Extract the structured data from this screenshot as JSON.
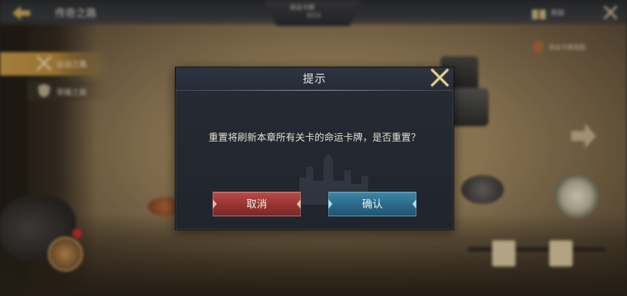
{
  "topbar": {
    "title": "传奇之路",
    "center_tab_line1": "命运卡牌",
    "center_tab_line2": "0/12"
  },
  "side_tabs": [
    {
      "label": "征战之路"
    },
    {
      "label": "荣耀之路"
    }
  ],
  "right_panel": {
    "top_label": "奖励",
    "sub_label": "命运卡牌奖励"
  },
  "dialog": {
    "title": "提示",
    "message": "重置将刷新本章所有关卡的命运卡牌，是否重置？",
    "cancel_label": "取消",
    "confirm_label": "确认"
  },
  "colors": {
    "cancel_button": "#923230",
    "confirm_button": "#2a6686",
    "close_icon": "#d8c48f",
    "dialog_bg": "#232830"
  },
  "icons": [
    "back-arrow-icon",
    "close-icon",
    "gift-icon",
    "swords-icon",
    "shield-icon",
    "close-x-icon"
  ]
}
